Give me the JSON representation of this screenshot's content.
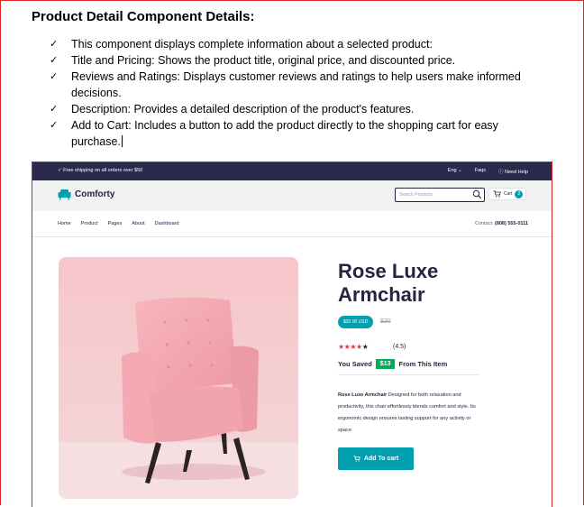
{
  "document": {
    "title": "Product Detail Component Details:",
    "bullets": [
      {
        "line1": "This component displays complete information about a selected product:"
      },
      {
        "line1": "Title and Pricing: Shows the product title, original price, and discounted price."
      },
      {
        "line1": "Reviews and Ratings: Displays customer reviews and ratings to help users make informed",
        "line2": "decisions."
      },
      {
        "line1": "Description: Provides a detailed description of the product's features."
      },
      {
        "line1": "Add to Cart: Includes a button to add the product directly to the shopping cart for easy",
        "line2": "purchase."
      }
    ]
  },
  "site": {
    "topbar": {
      "shipping": "Free shipping on all orders over $50",
      "language": "Eng",
      "faqs": "Faqs",
      "help": "Need Help"
    },
    "header": {
      "logo": "Comforty",
      "search_placeholder": "Search Products",
      "cart_label": "Cart",
      "cart_count": "2"
    },
    "nav": {
      "items": [
        "Home",
        "Product",
        "Pages",
        "About",
        "Dashboard"
      ],
      "contact_label": "Contact:",
      "contact_phone": "(808) 555-0111"
    },
    "product": {
      "title_line1": "Rose Luxe",
      "title_line2": "Armchair",
      "price": "$20.00 USD",
      "old_price": "$30",
      "rating": "(4.5)",
      "stars_filled": 4,
      "stars_total": 5,
      "saved_label": "You Saved",
      "saved_amount": "$13",
      "saved_suffix": "From This Item",
      "desc_name": "Rose Luxe Armchair",
      "desc_text": "Designed for both relaxation and productivity, this chair effortlessly blends comfort and style. Its ergonomic design ensures lasting support for any activity or space",
      "add_to_cart": "Add To cart"
    }
  },
  "colors": {
    "accent": "#029fae",
    "dark": "#272343",
    "topbar": "#2b2a4c",
    "save_green": "#01ad5a",
    "star_red": "#e53935",
    "frame_red": "#d9262b"
  }
}
